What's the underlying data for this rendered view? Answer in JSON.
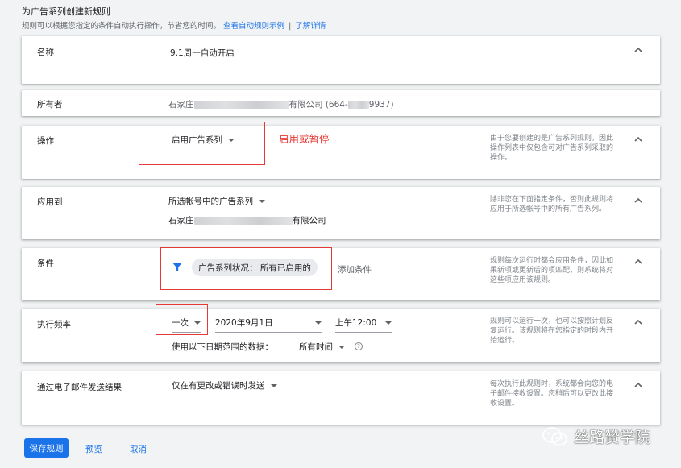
{
  "header": {
    "title": "为广告系列创建新规则",
    "description": "规则可以根据您指定的条件自动执行操作，节省您的时间。",
    "link_examples": "查看自动规则示例",
    "link_separator": "|",
    "link_learn_more": "了解详情"
  },
  "name_section": {
    "label": "名称",
    "value": "9.1周一自动开启"
  },
  "owner_section": {
    "label": "所有者",
    "value_prefix": "石家庄",
    "value_suffix": "有限公司 (664-",
    "value_end": "9937)"
  },
  "action_section": {
    "label": "操作",
    "selected": "启用广告系列",
    "annotation": "启用或暂停",
    "help": "由于您要创建的是广告系列规则，因此操作列表中仅包含可对广告系列采取的操作。"
  },
  "apply_section": {
    "label": "应用到",
    "selected": "所选帐号中的广告系列",
    "account_prefix": "石家庄",
    "account_suffix": "有限公司",
    "help": "除非您在下面指定条件，否则此规则将应用于所选帐号中的所有广告系列。"
  },
  "condition_section": {
    "label": "条件",
    "chip": "广告系列状况： 所有已启用的",
    "add_condition": "添加条件",
    "help": "规则每次运行时都会应用条件，因此如果新项或更新后的项匹配，则系统将对这些项应用该规则。"
  },
  "frequency_section": {
    "label": "执行频率",
    "frequency": "一次",
    "date": "2020年9月1日",
    "time": "上午12:00",
    "range_label": "使用以下日期范围的数据：",
    "range_value": "所有时间",
    "help": "规则可以运行一次，也可以按照计划反复运行。该规则将在您指定的时段内开始运行。"
  },
  "email_section": {
    "label": "通过电子邮件发送结果",
    "selected": "仅在有更改或错误时发送",
    "help": "每次执行此规则时，系统都会向您的电子邮件接收设置。您稍后可以更改此接收设置。"
  },
  "footer": {
    "save": "保存规则",
    "preview": "预览",
    "cancel": "取消"
  },
  "watermark": "丝路赞学院",
  "colors": {
    "primary": "#1a73e8",
    "annotation_red": "#e53935",
    "background": "#f1f3f4"
  }
}
